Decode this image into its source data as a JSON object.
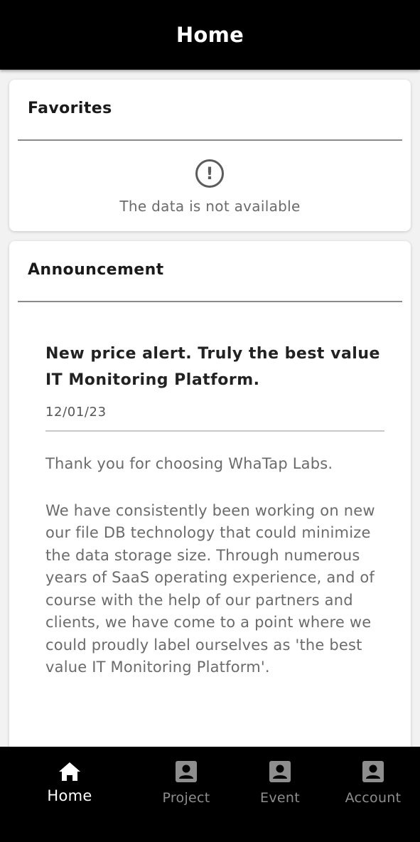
{
  "header": {
    "title": "Home"
  },
  "favorites": {
    "title": "Favorites",
    "empty_icon": "alert-circle-icon",
    "empty_text": "The data is not available"
  },
  "announcement": {
    "title": "Announcement",
    "post": {
      "title": "New price alert. Truly the best value IT Monitoring Platform.",
      "date": "12/01/23",
      "paragraphs": [
        "Thank you for choosing WhaTap Labs.",
        "We have consistently been working on new our file DB technology that could minimize the data storage size. Through numerous years of SaaS operating experience, and of course with the help of our partners and clients, we have come to a point where we could proudly label ourselves as 'the best value IT Monitoring Platform'."
      ]
    }
  },
  "bottom_nav": {
    "items": [
      {
        "label": "Home",
        "icon": "home-icon",
        "active": true
      },
      {
        "label": "Project",
        "icon": "account-box-icon",
        "active": false
      },
      {
        "label": "Event",
        "icon": "account-box-icon",
        "active": false
      },
      {
        "label": "Account",
        "icon": "account-box-icon",
        "active": false
      }
    ]
  },
  "colors": {
    "bar": "#000000",
    "active": "#ffffff",
    "inactive": "#8e8e8e",
    "background": "#f2f2f2"
  }
}
